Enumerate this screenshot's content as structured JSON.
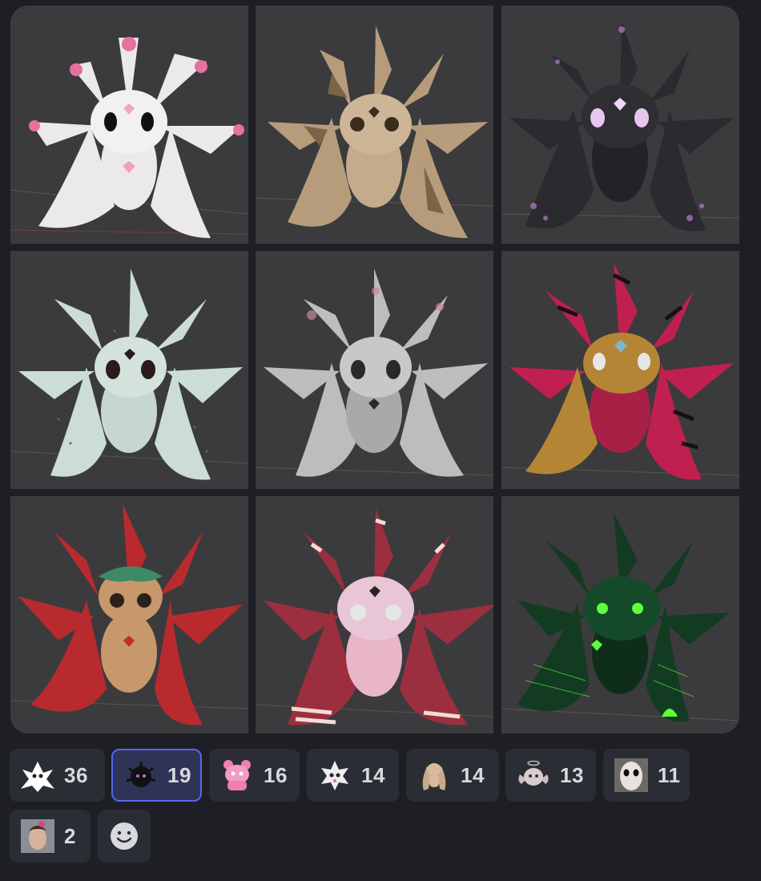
{
  "gallery": {
    "tiles": [
      {
        "name": "white-pink-plush-render",
        "body": "#eceae8",
        "accent": "#e6709e",
        "eye": "#111111"
      },
      {
        "name": "burlap-patchwork-plush-render",
        "body": "#b79c7c",
        "accent": "#7c6448",
        "eye": "#3a2c1e"
      },
      {
        "name": "black-glitter-plush-render",
        "body": "#2b2a2e",
        "accent": "#b77bd3",
        "eye": "#e7c6f0"
      },
      {
        "name": "mint-speckled-plush-render",
        "body": "#ccdcd6",
        "accent": "#9fb4ac",
        "eye": "#2a1c18"
      },
      {
        "name": "chrome-floral-plush-render",
        "body": "#bdbdc0",
        "accent": "#c98a93",
        "eye": "#2a2a2a"
      },
      {
        "name": "leopard-zebra-plush-render",
        "body": "#c0204f",
        "accent": "#b58536",
        "eye": "#e6e6e6"
      },
      {
        "name": "red-gingerbread-plush-render",
        "body": "#b92a2e",
        "accent": "#c7986b",
        "eye": "#2b211b"
      },
      {
        "name": "pink-striped-plush-render",
        "body": "#9c2f3f",
        "accent": "#e8b5c9",
        "eye": "#2b2020"
      },
      {
        "name": "neon-green-plush-render",
        "body": "#123b22",
        "accent": "#5fff3c",
        "eye": "#5fff3c"
      }
    ]
  },
  "reactions": [
    {
      "name": "reaction-white-creature",
      "count": "36",
      "icon": "white-creature-icon",
      "selected": false
    },
    {
      "name": "reaction-black-creature",
      "count": "19",
      "icon": "black-creature-icon",
      "selected": true
    },
    {
      "name": "reaction-pink-bear",
      "count": "16",
      "icon": "pink-bear-icon",
      "selected": false
    },
    {
      "name": "reaction-white-bunny",
      "count": "14",
      "icon": "white-bunny-icon",
      "selected": false
    },
    {
      "name": "reaction-tan-bunny",
      "count": "14",
      "icon": "tan-bunny-icon",
      "selected": false
    },
    {
      "name": "reaction-angel-bunny",
      "count": "13",
      "icon": "angel-bunny-icon",
      "selected": false
    },
    {
      "name": "reaction-pale-face",
      "count": "11",
      "icon": "pale-face-icon",
      "selected": false
    },
    {
      "name": "reaction-selfie",
      "count": "2",
      "icon": "selfie-photo-icon",
      "selected": false
    }
  ],
  "add_reaction": {
    "icon": "add-reaction-smiley-icon"
  },
  "colors": {
    "active_border": "#5865f2",
    "chip_bg": "#2b2d35",
    "page_bg": "#1e1f25"
  }
}
